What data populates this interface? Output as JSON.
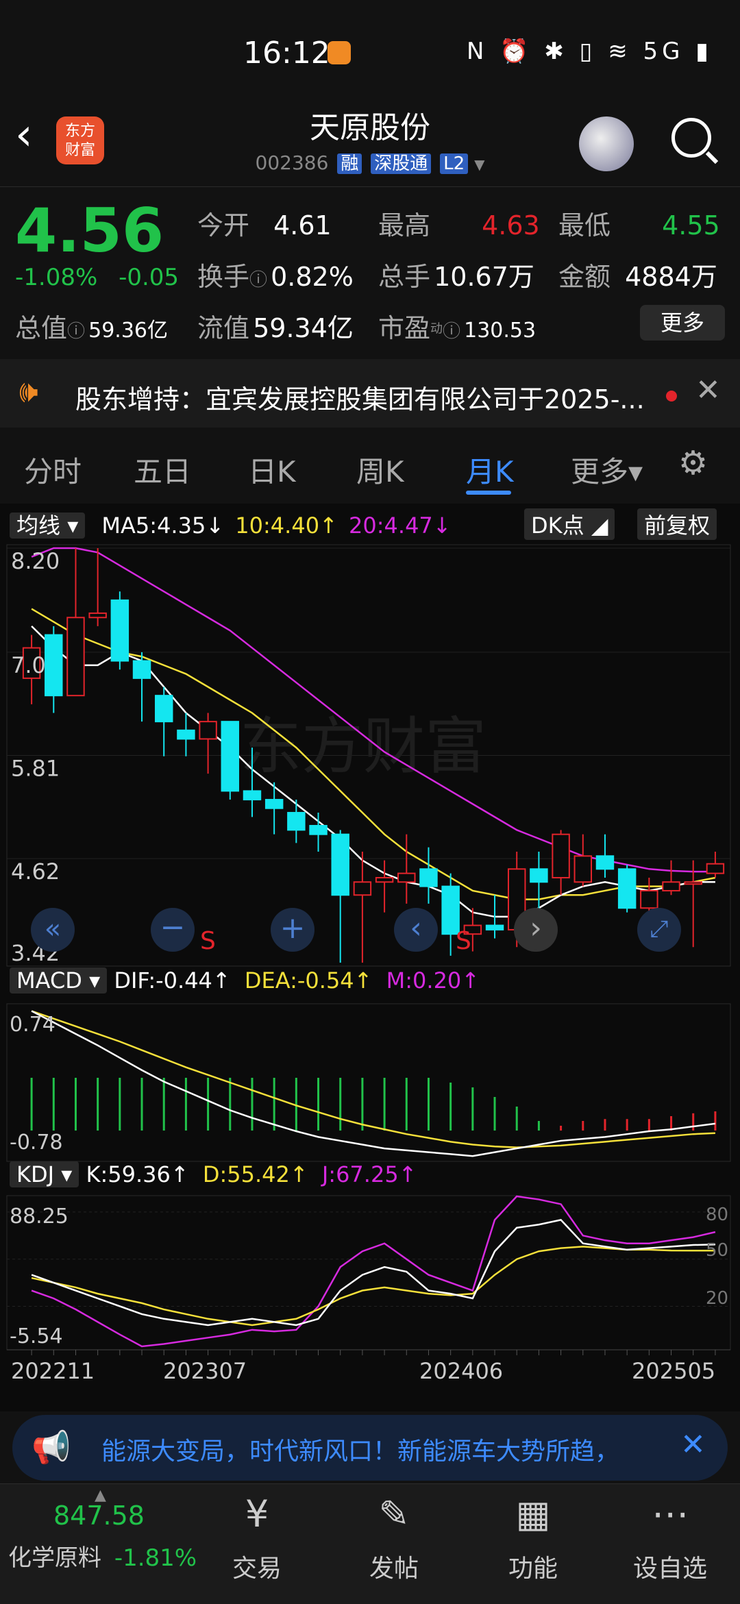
{
  "status": {
    "time": "16:12",
    "icons": "N ⏰ ✱ ▯ ≋ 5G ▮"
  },
  "header": {
    "logo_line1": "东方",
    "logo_line2": "财富",
    "title": "天原股份",
    "code": "002386",
    "tags": [
      "融",
      "深股通",
      "L2"
    ]
  },
  "quote": {
    "price": "4.56",
    "pct": "-1.08%",
    "change": "-0.05",
    "open_label": "今开",
    "open": "4.61",
    "high_label": "最高",
    "high": "4.63",
    "low_label": "最低",
    "low": "4.55",
    "turnover_label": "换手",
    "turnover": "0.82%",
    "volume_label": "总手",
    "volume": "10.67万",
    "amount_label": "金额",
    "amount": "4884万",
    "mktcap_label": "总值",
    "mktcap": "59.36亿",
    "float_label": "流值",
    "float": "59.34亿",
    "pe_label": "市盈",
    "pe_sup": "动",
    "pe": "130.53",
    "more": "更多",
    "colors": {
      "up": "#e3242b",
      "down": "#21c24a"
    }
  },
  "notice": {
    "text": "股东增持：宜宾发展控股集团有限公司于2025-..."
  },
  "tabs": [
    "分时",
    "五日",
    "日K",
    "周K",
    "月K",
    "更多▾"
  ],
  "active_tab": "月K",
  "kline": {
    "indicator": "均线",
    "ma5": "MA5:4.35↓",
    "ma10": "10:4.40↑",
    "ma20": "20:4.47↓",
    "dk": "DK点",
    "adjust": "前复权",
    "yticks": [
      "8.20",
      "7.0",
      "5.81",
      "4.62",
      "3.42"
    ],
    "watermark": "东方财富",
    "signals": [
      "S",
      "S"
    ]
  },
  "macd": {
    "label": "MACD",
    "dif": "DIF:-0.44↑",
    "dea": "DEA:-0.54↑",
    "m": "M:0.20↑",
    "ytop": "0.74",
    "ybot": "-0.78"
  },
  "kdj": {
    "label": "KDJ",
    "k": "K:59.36↑",
    "d": "D:55.42↑",
    "j": "J:67.25↑",
    "ytop": "88.25",
    "ybot": "-5.54",
    "r80": "80",
    "r50": "50",
    "r20": "20"
  },
  "xaxis": [
    "202211",
    "202307",
    "202406",
    "202505"
  ],
  "chart_data": {
    "type": "candlestick",
    "candles": [
      {
        "o": 6.7,
        "c": 7.05,
        "h": 7.2,
        "l": 6.4
      },
      {
        "o": 7.2,
        "c": 6.5,
        "h": 7.3,
        "l": 6.3
      },
      {
        "o": 6.5,
        "c": 7.4,
        "h": 8.2,
        "l": 6.5
      },
      {
        "o": 7.4,
        "c": 7.45,
        "h": 8.2,
        "l": 7.3
      },
      {
        "o": 7.6,
        "c": 6.9,
        "h": 7.7,
        "l": 6.8
      },
      {
        "o": 6.9,
        "c": 6.7,
        "h": 7.0,
        "l": 6.2
      },
      {
        "o": 6.5,
        "c": 6.2,
        "h": 6.6,
        "l": 5.8
      },
      {
        "o": 6.1,
        "c": 6.0,
        "h": 6.3,
        "l": 5.8
      },
      {
        "o": 6.0,
        "c": 6.2,
        "h": 6.3,
        "l": 5.6
      },
      {
        "o": 6.2,
        "c": 5.4,
        "h": 6.2,
        "l": 5.3
      },
      {
        "o": 5.4,
        "c": 5.3,
        "h": 5.9,
        "l": 5.1
      },
      {
        "o": 5.3,
        "c": 5.2,
        "h": 5.5,
        "l": 4.9
      },
      {
        "o": 5.15,
        "c": 4.95,
        "h": 5.3,
        "l": 4.8
      },
      {
        "o": 5.0,
        "c": 4.9,
        "h": 5.15,
        "l": 4.7
      },
      {
        "o": 4.9,
        "c": 4.2,
        "h": 4.95,
        "l": 3.42
      },
      {
        "o": 4.2,
        "c": 4.35,
        "h": 4.7,
        "l": 3.42
      },
      {
        "o": 4.35,
        "c": 4.4,
        "h": 4.6,
        "l": 4.0
      },
      {
        "o": 4.35,
        "c": 4.45,
        "h": 4.9,
        "l": 4.1
      },
      {
        "o": 4.5,
        "c": 4.3,
        "h": 4.75,
        "l": 4.1
      },
      {
        "o": 4.3,
        "c": 3.75,
        "h": 4.45,
        "l": 3.5
      },
      {
        "o": 3.75,
        "c": 3.85,
        "h": 4.05,
        "l": 3.55
      },
      {
        "o": 3.85,
        "c": 3.8,
        "h": 4.2,
        "l": 3.7
      },
      {
        "o": 3.8,
        "c": 4.5,
        "h": 4.7,
        "l": 3.6
      },
      {
        "o": 4.5,
        "c": 4.35,
        "h": 4.7,
        "l": 4.0
      },
      {
        "o": 4.4,
        "c": 4.9,
        "h": 4.95,
        "l": 4.2
      },
      {
        "o": 4.35,
        "c": 4.65,
        "h": 4.9,
        "l": 4.3
      },
      {
        "o": 4.65,
        "c": 4.5,
        "h": 4.9,
        "l": 4.4
      },
      {
        "o": 4.5,
        "c": 4.05,
        "h": 4.55,
        "l": 4.0
      },
      {
        "o": 4.05,
        "c": 4.25,
        "h": 4.4,
        "l": 4.0
      },
      {
        "o": 4.25,
        "c": 4.35,
        "h": 4.6,
        "l": 4.2
      },
      {
        "o": 4.35,
        "c": 4.35,
        "h": 4.6,
        "l": 3.6
      },
      {
        "o": 4.45,
        "c": 4.56,
        "h": 4.7,
        "l": 4.4
      }
    ],
    "ma5": [
      7.3,
      7.05,
      6.85,
      6.85,
      7.0,
      6.9,
      6.6,
      6.3,
      6.1,
      5.9,
      5.65,
      5.45,
      5.25,
      5.05,
      4.85,
      4.6,
      4.45,
      4.35,
      4.3,
      4.2,
      4.0,
      3.95,
      3.95,
      4.05,
      4.2,
      4.3,
      4.35,
      4.3,
      4.25,
      4.3,
      4.35,
      4.35
    ],
    "ma10": [
      7.5,
      7.35,
      7.2,
      7.1,
      7.0,
      6.95,
      6.85,
      6.75,
      6.6,
      6.45,
      6.3,
      6.1,
      5.9,
      5.65,
      5.4,
      5.15,
      4.9,
      4.7,
      4.55,
      4.4,
      4.25,
      4.2,
      4.15,
      4.15,
      4.2,
      4.2,
      4.25,
      4.3,
      4.3,
      4.3,
      4.35,
      4.4
    ],
    "ma20": [
      8.1,
      8.2,
      8.2,
      8.15,
      8.0,
      7.85,
      7.7,
      7.55,
      7.4,
      7.25,
      7.05,
      6.85,
      6.65,
      6.45,
      6.25,
      6.05,
      5.85,
      5.7,
      5.55,
      5.4,
      5.25,
      5.1,
      4.95,
      4.85,
      4.75,
      4.65,
      4.6,
      4.55,
      4.5,
      4.48,
      4.47,
      4.47
    ],
    "macd_hist": [
      -0.55,
      -0.55,
      -0.55,
      -0.55,
      -0.55,
      -0.55,
      -0.55,
      -0.55,
      -0.55,
      -0.55,
      -0.55,
      -0.55,
      -0.55,
      -0.55,
      -0.55,
      -0.55,
      -0.55,
      -0.55,
      -0.55,
      -0.5,
      -0.45,
      -0.35,
      -0.25,
      -0.1,
      0.05,
      0.1,
      0.12,
      0.12,
      0.12,
      0.15,
      0.18,
      0.2
    ],
    "dif": [
      0.74,
      0.62,
      0.5,
      0.38,
      0.25,
      0.12,
      0.0,
      -0.1,
      -0.2,
      -0.3,
      -0.38,
      -0.45,
      -0.52,
      -0.58,
      -0.62,
      -0.66,
      -0.7,
      -0.72,
      -0.74,
      -0.76,
      -0.78,
      -0.74,
      -0.7,
      -0.66,
      -0.62,
      -0.6,
      -0.58,
      -0.55,
      -0.52,
      -0.5,
      -0.47,
      -0.44
    ],
    "dea": [
      0.74,
      0.66,
      0.58,
      0.5,
      0.42,
      0.33,
      0.24,
      0.15,
      0.07,
      -0.01,
      -0.09,
      -0.17,
      -0.25,
      -0.32,
      -0.39,
      -0.45,
      -0.5,
      -0.55,
      -0.59,
      -0.63,
      -0.66,
      -0.68,
      -0.69,
      -0.68,
      -0.67,
      -0.65,
      -0.63,
      -0.61,
      -0.59,
      -0.57,
      -0.55,
      -0.54
    ],
    "k": [
      40,
      35,
      30,
      25,
      20,
      15,
      12,
      10,
      8,
      10,
      12,
      10,
      8,
      12,
      30,
      40,
      45,
      42,
      30,
      28,
      25,
      55,
      70,
      72,
      75,
      60,
      58,
      56,
      57,
      58,
      59,
      59.36
    ],
    "d": [
      38,
      35,
      32,
      28,
      25,
      22,
      18,
      15,
      12,
      10,
      8,
      10,
      12,
      18,
      25,
      30,
      32,
      30,
      28,
      27,
      28,
      40,
      50,
      55,
      57,
      58,
      57,
      56,
      56,
      55.5,
      55.4,
      55.42
    ],
    "j": [
      30,
      25,
      18,
      10,
      2,
      -5.54,
      -4,
      -2,
      0,
      2,
      5,
      4,
      5,
      20,
      45,
      55,
      60,
      50,
      40,
      35,
      30,
      75,
      90,
      88,
      85,
      65,
      62,
      60,
      60,
      62,
      64,
      67.25
    ]
  },
  "banner": {
    "text": "能源大变局，时代新风口！新能源车大势所趋，"
  },
  "bottom": {
    "index_value": "847.58",
    "index_name": "化学原料",
    "index_pct": "-1.81%",
    "nav": [
      "交易",
      "发帖",
      "功能",
      "设自选"
    ]
  }
}
